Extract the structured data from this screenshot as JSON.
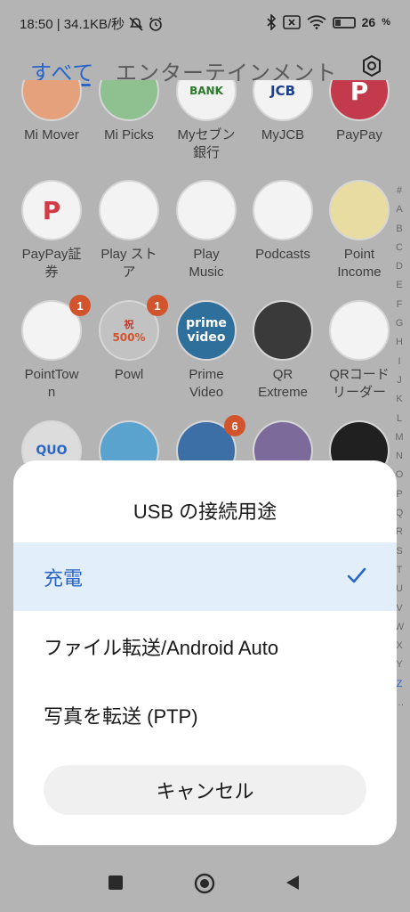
{
  "status": {
    "time_speed": "18:50 | 34.1KB/秒",
    "battery": "26"
  },
  "tabs": {
    "all": "すべて",
    "entertainment": "エンターテインメント"
  },
  "apps": [
    {
      "label": "Mi Mover",
      "color": "#e5a07c"
    },
    {
      "label": "Mi Picks",
      "color": "#8fc08f"
    },
    {
      "label": "Myセブン\n銀行",
      "color": "#f2f2f2"
    },
    {
      "label": "MyJCB",
      "color": "#f3f3f3"
    },
    {
      "label": "PayPay",
      "color": "#c33a4d"
    },
    {
      "label": "PayPay証\n券",
      "color": "#f3f3f3"
    },
    {
      "label": "Play スト\nア",
      "color": "#f3f3f3"
    },
    {
      "label": "Play\nMusic",
      "color": "#f3f3f3"
    },
    {
      "label": "Podcasts",
      "color": "#f3f3f3"
    },
    {
      "label": "Point\nIncome",
      "color": "#e9dca0"
    },
    {
      "label": "PointTow\nn",
      "color": "#f3f3f3",
      "badge": "1"
    },
    {
      "label": "Powl",
      "color": "#c2c2c2",
      "badge": "1"
    },
    {
      "label": "Prime\nVideo",
      "color": "#2f6f9c"
    },
    {
      "label": "QR\nExtreme",
      "color": "#3a3a3a"
    },
    {
      "label": "QRコード\nリーダー",
      "color": "#f3f3f3"
    },
    {
      "label": "",
      "color": "#dcdcdc"
    },
    {
      "label": "",
      "color": "#5aa3cf"
    },
    {
      "label": "",
      "color": "#3c6fa6",
      "badge": "6"
    },
    {
      "label": "",
      "color": "#7b6a9a"
    },
    {
      "label": "",
      "color": "#202020"
    }
  ],
  "icon_text": {
    "paypay": "P",
    "paypay_sec": "P",
    "jcb": "JCB",
    "seven_bank": "BANK",
    "prime1": "prime",
    "prime2": "video",
    "powl_badge": "祝",
    "powl_500": "500%",
    "quo": "QUO"
  },
  "index_letters": [
    "#",
    "A",
    "B",
    "C",
    "D",
    "E",
    "F",
    "G",
    "H",
    "I",
    "J",
    "K",
    "L",
    "M",
    "N",
    "O",
    "P",
    "Q",
    "R",
    "S",
    "T",
    "U",
    "V",
    "W",
    "X",
    "Y",
    "Z",
    "…"
  ],
  "dialog": {
    "title": "USB の接続用途",
    "options": [
      {
        "label": "充電",
        "selected": true
      },
      {
        "label": "ファイル転送/Android Auto",
        "selected": false
      },
      {
        "label": "写真を転送 (PTP)",
        "selected": false
      }
    ],
    "cancel": "キャンセル"
  },
  "colors": {
    "accent": "#2a66c8",
    "selected_bg": "#e3eefb",
    "badge": "#d2542c"
  }
}
